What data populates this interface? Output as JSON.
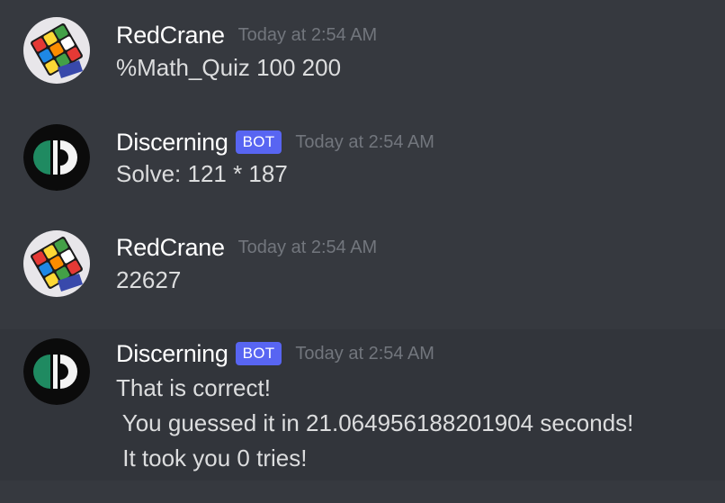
{
  "messages": [
    {
      "author": "RedCrane",
      "timestamp": "Today at 2:54 AM",
      "avatar": "rubiks-cube-avatar",
      "lines": [
        "%Math_Quiz 100 200"
      ]
    },
    {
      "author": "Discerning",
      "badge": "BOT",
      "timestamp": "Today at 2:54 AM",
      "avatar": "discerning-bot-logo",
      "lines": [
        "Solve: 121 * 187"
      ]
    },
    {
      "author": "RedCrane",
      "timestamp": "Today at 2:54 AM",
      "avatar": "rubiks-cube-avatar",
      "lines": [
        "22627"
      ]
    },
    {
      "author": "Discerning",
      "badge": "BOT",
      "timestamp": "Today at 2:54 AM",
      "avatar": "discerning-bot-logo",
      "lines": [
        "That is correct!",
        " You guessed it in 21.064956188201904 seconds!",
        " It took you 0 tries!"
      ]
    }
  ],
  "colors": {
    "background": "#36393f",
    "highlight": "#32353b",
    "username": "#ffffff",
    "timestamp": "#72767d",
    "message_text": "#dcddde",
    "bot_badge": "#5865f2"
  }
}
